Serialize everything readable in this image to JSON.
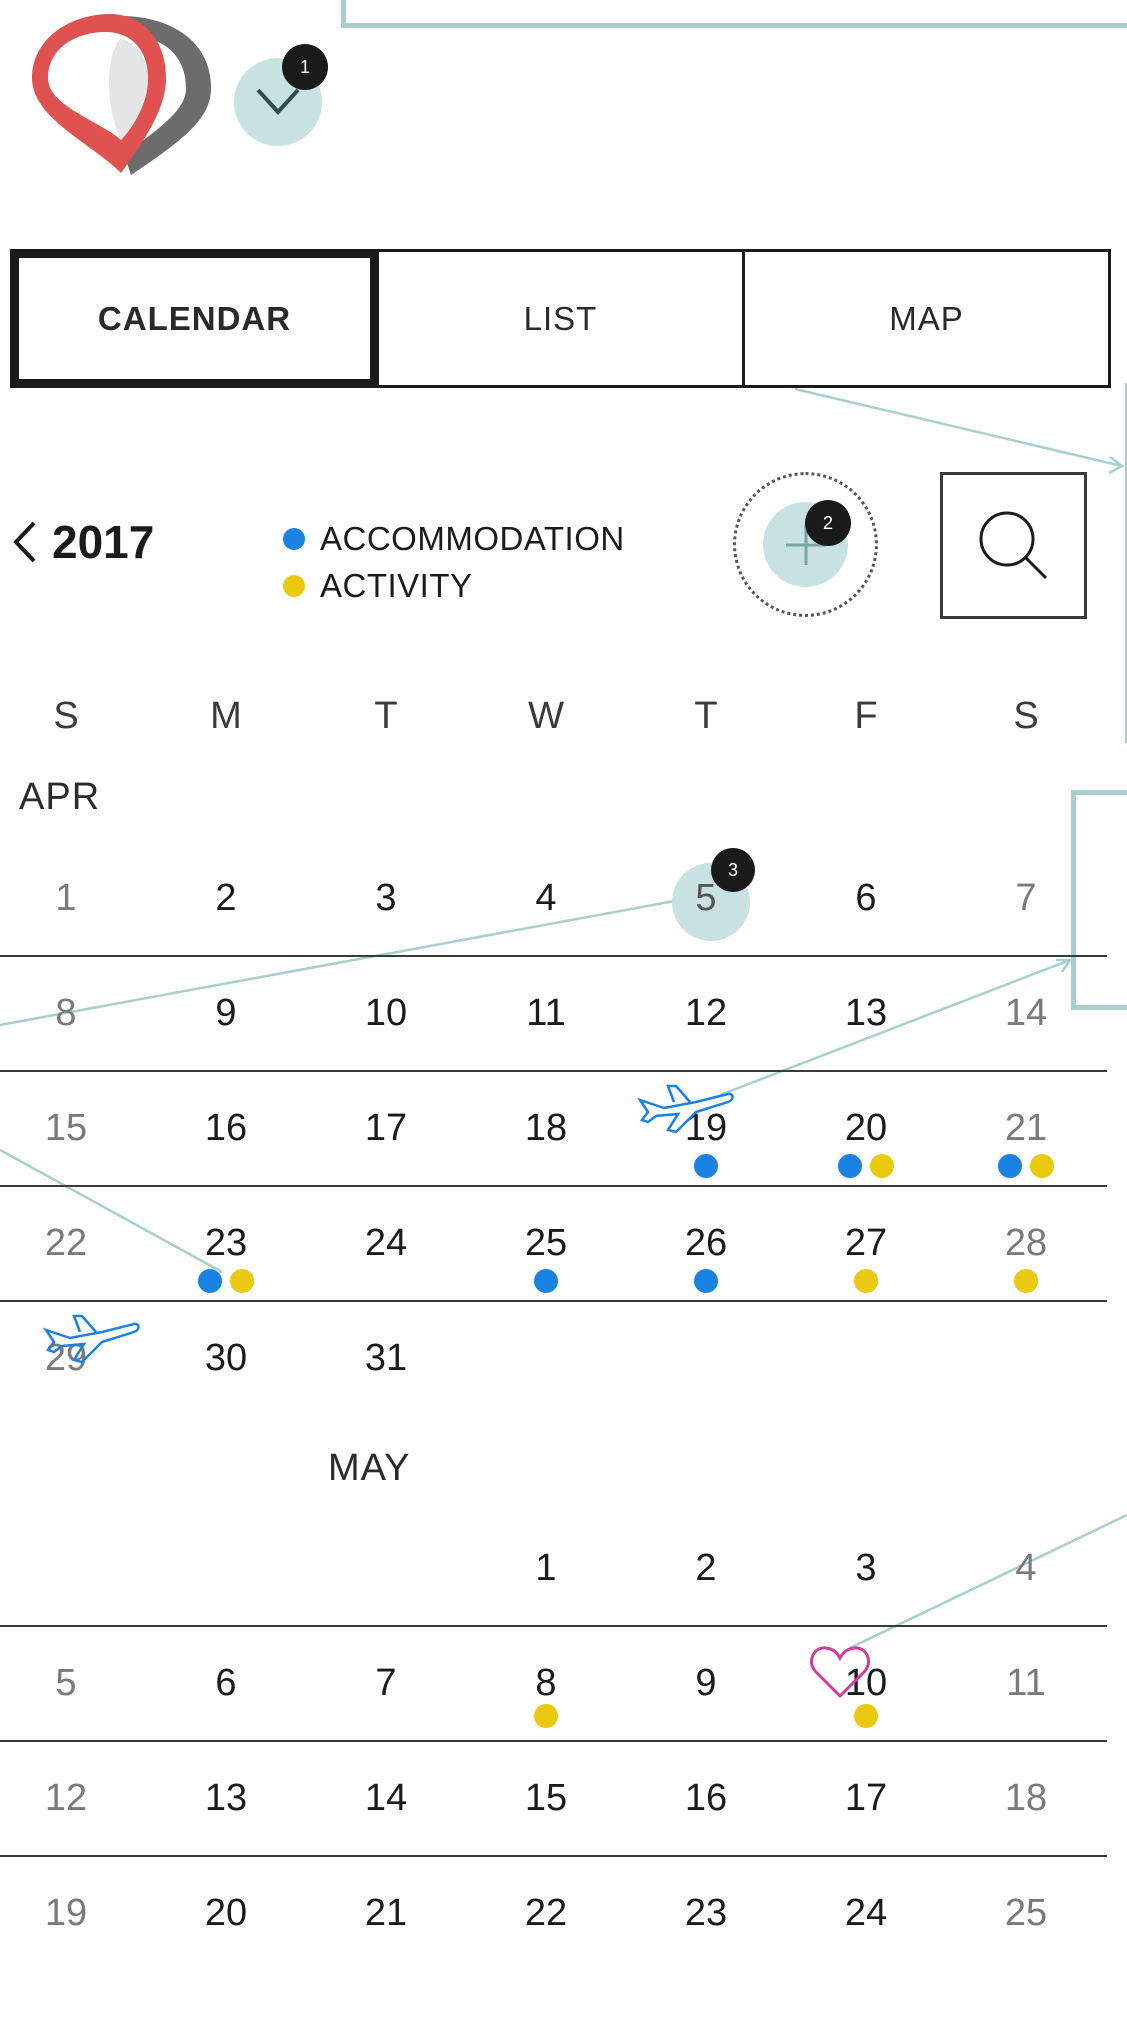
{
  "badges": {
    "one": "1",
    "two": "2",
    "three": "3"
  },
  "tabs": [
    {
      "label": "CALENDAR",
      "active": true
    },
    {
      "label": "LIST",
      "active": false
    },
    {
      "label": "MAP",
      "active": false
    }
  ],
  "header": {
    "year": "2017",
    "prev_icon": "chevron-left-icon",
    "add_icon": "plus-icon",
    "search_icon": "search-icon"
  },
  "legend": {
    "accommodation": {
      "label": "ACCOMMODATION",
      "color": "#1a82e2"
    },
    "activity": {
      "label": "ACTIVITY",
      "color": "#e9c80e"
    }
  },
  "weekdays": [
    "S",
    "M",
    "T",
    "W",
    "T",
    "F",
    "S"
  ],
  "months": {
    "april": {
      "label": "APR",
      "weeks": [
        [
          "1",
          "2",
          "3",
          "4",
          "5",
          "6",
          "7"
        ],
        [
          "8",
          "9",
          "10",
          "11",
          "12",
          "13",
          "14"
        ],
        [
          "15",
          "16",
          "17",
          "18",
          "19",
          "20",
          "21"
        ],
        [
          "22",
          "23",
          "24",
          "25",
          "26",
          "27",
          "28"
        ],
        [
          "29",
          "30",
          "31",
          "",
          "",
          "",
          ""
        ]
      ]
    },
    "may": {
      "label": "MAY",
      "weeks": [
        [
          "",
          "",
          "",
          "1",
          "2",
          "3",
          "4"
        ],
        [
          "5",
          "6",
          "7",
          "8",
          "9",
          "10",
          "11"
        ],
        [
          "12",
          "13",
          "14",
          "15",
          "16",
          "17",
          "18"
        ],
        [
          "19",
          "20",
          "21",
          "22",
          "23",
          "24",
          "25"
        ]
      ]
    }
  },
  "colors": {
    "accent_teal": "#a7cfcf",
    "teal_fill": "#c8e1e1",
    "heart": "#d43b9c",
    "logo_red": "#e0524f",
    "logo_gray": "#6c6c6c"
  }
}
